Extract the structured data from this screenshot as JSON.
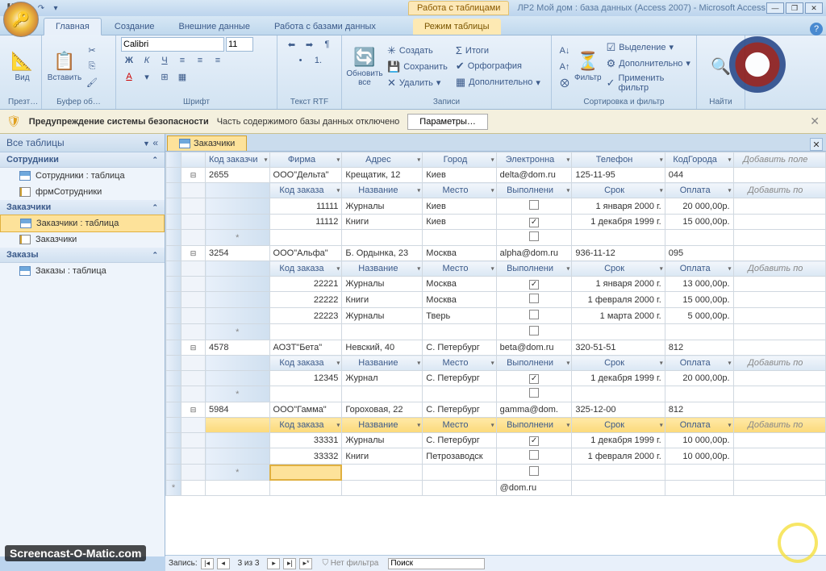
{
  "titlebar": {
    "tab_tools": "Работа с таблицами",
    "title": "ЛР2 Мой дом : база данных (Access 2007) - Microsoft Access"
  },
  "ribbon": {
    "tabs": [
      "Главная",
      "Создание",
      "Внешние данные",
      "Работа с базами данных",
      "Режим таблицы"
    ],
    "view": "Вид",
    "paste": "Вставить",
    "clipboard_lbl": "Презт…",
    "clipboard_lbl2": "Буфер об…",
    "font_name": "Calibri",
    "font_size": "11",
    "font_lbl": "Шрифт",
    "rtf_lbl": "Текст RTF",
    "refresh": "Обновить все",
    "new": "Создать",
    "save": "Сохранить",
    "delete": "Удалить",
    "totals": "Итоги",
    "spell": "Орфография",
    "more": "Дополнительно",
    "records_lbl": "Записи",
    "filter": "Фильтр",
    "selection": "Выделение",
    "advanced": "Дополнительно",
    "apply_filter": "Применить фильтр",
    "sortfilter_lbl": "Сортировка и фильтр",
    "find_lbl": "Найти"
  },
  "security": {
    "label": "Предупреждение системы безопасности",
    "text": "Часть содержимого базы данных отключено",
    "btn": "Параметры…"
  },
  "nav": {
    "header": "Все таблицы",
    "groups": [
      {
        "title": "Сотрудники",
        "items": [
          {
            "icon": "table",
            "label": "Сотрудники : таблица"
          },
          {
            "icon": "form",
            "label": "фрмСотрудники"
          }
        ]
      },
      {
        "title": "Заказчики",
        "items": [
          {
            "icon": "table",
            "label": "Заказчики : таблица",
            "selected": true
          },
          {
            "icon": "form",
            "label": "Заказчики"
          }
        ]
      },
      {
        "title": "Заказы",
        "items": [
          {
            "icon": "table",
            "label": "Заказы : таблица"
          }
        ]
      }
    ]
  },
  "doc": {
    "tab_label": "Заказчики",
    "main_cols": [
      "Код заказчи",
      "Фирма",
      "Адрес",
      "Город",
      "Электронна",
      "Телефон",
      "КодГорода"
    ],
    "add_field": "Добавить поле",
    "sub_cols": [
      "Код заказа",
      "Название",
      "Место",
      "Выполнени",
      "Срок",
      "Оплата"
    ],
    "add_po": "Добавить по",
    "rows": [
      {
        "id": "2655",
        "firm": "ООО\"Дельта\"",
        "addr": "Крещатик, 12",
        "city": "Киев",
        "email": "delta@dom.ru",
        "tel": "125-11-95",
        "code": "044",
        "orders": [
          {
            "id": "11111",
            "name": "Журналы",
            "place": "Киев",
            "done": false,
            "due": "1 января 2000 г.",
            "pay": "20 000,00р."
          },
          {
            "id": "11112",
            "name": "Книги",
            "place": "Киев",
            "done": true,
            "due": "1 декабря 1999 г.",
            "pay": "15 000,00р."
          }
        ]
      },
      {
        "id": "3254",
        "firm": "ООО\"Альфа\"",
        "addr": "Б. Ордынка, 23",
        "city": "Москва",
        "email": "alpha@dom.ru",
        "tel": "936-11-12",
        "code": "095",
        "orders": [
          {
            "id": "22221",
            "name": "Журналы",
            "place": "Москва",
            "done": true,
            "due": "1 января 2000 г.",
            "pay": "13 000,00р."
          },
          {
            "id": "22222",
            "name": "Книги",
            "place": "Москва",
            "done": false,
            "due": "1 февраля 2000 г.",
            "pay": "15 000,00р."
          },
          {
            "id": "22223",
            "name": "Журналы",
            "place": "Тверь",
            "done": false,
            "due": "1 марта 2000 г.",
            "pay": "5 000,00р."
          }
        ]
      },
      {
        "id": "4578",
        "firm": "АОЗТ\"Бета\"",
        "addr": "Невский, 40",
        "city": "С. Петербург",
        "email": "beta@dom.ru",
        "tel": "320-51-51",
        "code": "812",
        "orders": [
          {
            "id": "12345",
            "name": "Журнал",
            "place": "С. Петербург",
            "done": true,
            "due": "1 декабря 1999 г.",
            "pay": "20 000,00р."
          }
        ]
      },
      {
        "id": "5984",
        "firm": "ООО\"Гамма\"",
        "addr": "Гороховая, 22",
        "city": "С. Петербург",
        "email": "gamma@dom.",
        "tel": "325-12-00",
        "code": "812",
        "hot": true,
        "orders": [
          {
            "id": "33331",
            "name": "Журналы",
            "place": "С. Петербург",
            "done": true,
            "due": "1 декабря 1999 г.",
            "pay": "10 000,00р."
          },
          {
            "id": "33332",
            "name": "Книги",
            "place": "Петрозаводск",
            "done": false,
            "due": "1 февраля 2000 г.",
            "pay": "10 000,00р."
          }
        ]
      }
    ],
    "new_email": "@dom.ru"
  },
  "recnav": {
    "label": "Запись:",
    "pos": "3 из 3",
    "filter": "Нет фильтра",
    "search": "Поиск"
  },
  "watermark": "Screencast-O-Matic.com"
}
